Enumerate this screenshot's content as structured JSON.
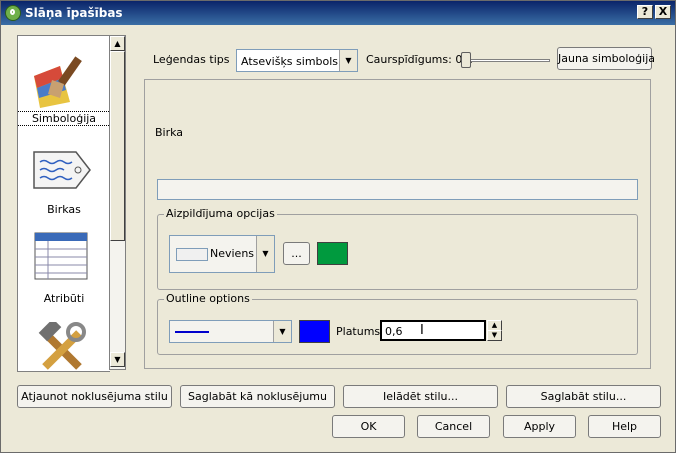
{
  "window": {
    "title": "Slāņa īpašības",
    "help_label": "?",
    "close_label": "X"
  },
  "sidebar": {
    "items": [
      {
        "label": "Simboloģija"
      },
      {
        "label": "Birkas"
      },
      {
        "label": "Atribūti"
      },
      {
        "label": ""
      }
    ]
  },
  "toolbar": {
    "legend_type_label": "Leģendas tips",
    "legend_type_value": "Atsevišķs simbols",
    "transparency_label": "Caurspīdīgums: 0%",
    "transparency_value": 0,
    "new_symbology_label": "Jauna simboloģija"
  },
  "panel": {
    "label_heading": "Birka",
    "label_value": "",
    "fill_group": {
      "title": "Aizpildījuma opcijas",
      "style_value": "Neviens",
      "more_label": "...",
      "color": "#009a3e"
    },
    "outline_group": {
      "title": "Outline options",
      "color": "#0000ff",
      "width_label": "Platums",
      "width_value": "0,6"
    }
  },
  "style_buttons": {
    "restore": "Atjaunot noklusējuma stilu",
    "save_default": "Saglabāt kā noklusējumu",
    "load": "Ielādēt stilu...",
    "save": "Saglabāt stilu..."
  },
  "dialog_buttons": {
    "ok": "OK",
    "cancel": "Cancel",
    "apply": "Apply",
    "help": "Help"
  }
}
